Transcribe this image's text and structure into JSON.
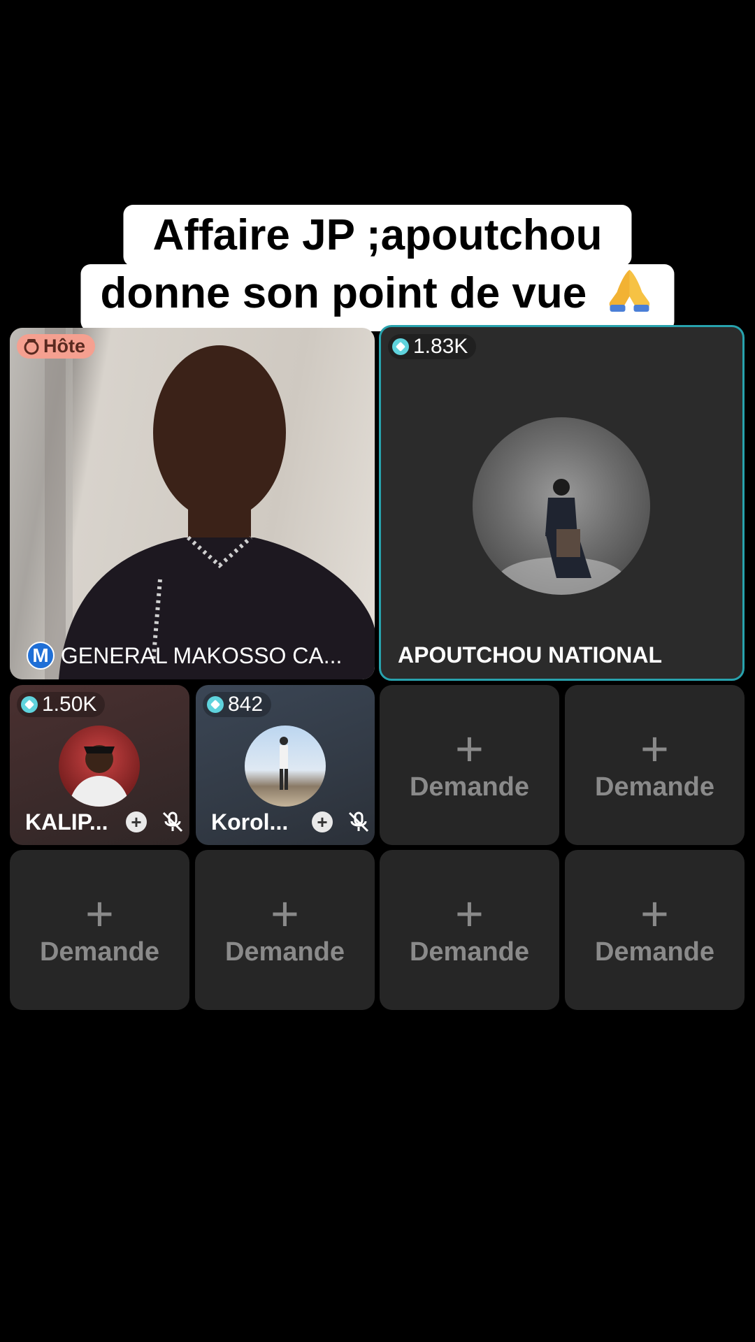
{
  "caption": {
    "line1": "Affaire JP ;apoutchou",
    "line2": "donne son point de vue",
    "emoji_icon": "folded-hands-emoji"
  },
  "host_tile": {
    "badge": "Hôte",
    "badge_icon": "host-face-icon",
    "name_badge": "M",
    "name": "GENERAL MAKOSSO CA..."
  },
  "guest_tile": {
    "count": "1.83K",
    "name": "APOUTCHOU NATIONAL",
    "active_border_color": "#28a2ad"
  },
  "small_guests": [
    {
      "count": "1.50K",
      "name": "KALIP..."
    },
    {
      "count": "842",
      "name": "Korol..."
    }
  ],
  "request_slot_label": "Demande",
  "request_slots": [
    "Demande",
    "Demande",
    "Demande",
    "Demande",
    "Demande",
    "Demande"
  ]
}
